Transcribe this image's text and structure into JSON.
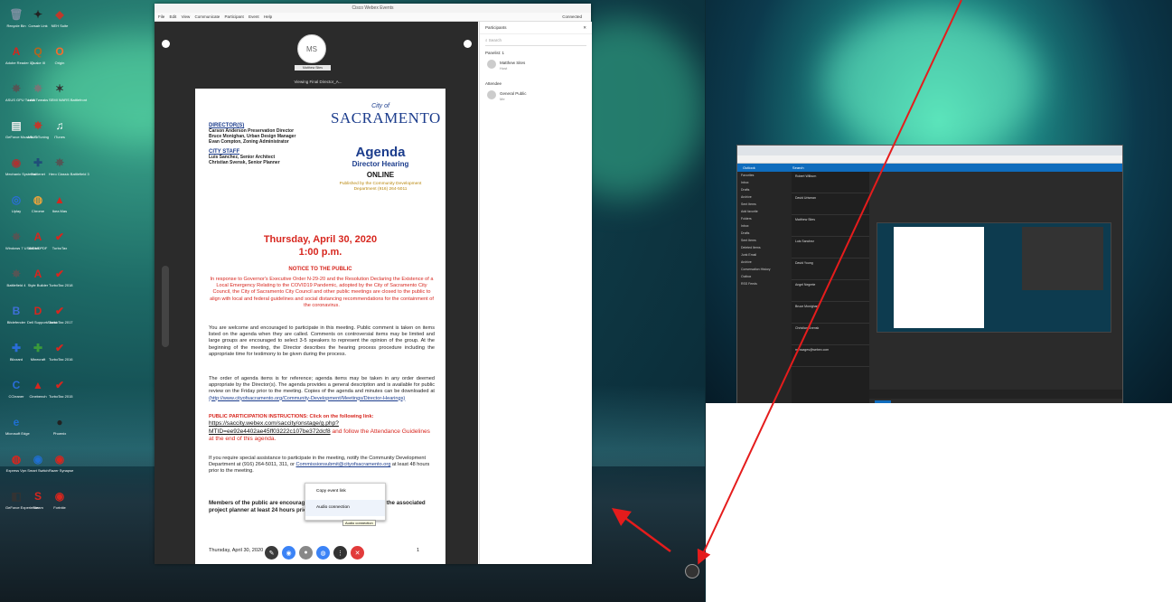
{
  "desktop": {
    "icons": [
      {
        "label": "Recycle Bin",
        "glyph": "🗑",
        "color": "#7a8fa0"
      },
      {
        "label": "Corsair Link",
        "glyph": "✦",
        "color": "#222"
      },
      {
        "label": "NEH Suite",
        "glyph": "◆",
        "color": "#c0392b"
      },
      {
        "label": "Adobe Reader XI",
        "glyph": "A",
        "color": "#d7261e"
      },
      {
        "label": "Quake III",
        "glyph": "Q",
        "color": "#b5651d"
      },
      {
        "label": "Origin",
        "glyph": "O",
        "color": "#f56c2d"
      },
      {
        "label": "ASUS GPU Tweak",
        "glyph": "✸",
        "color": "#555"
      },
      {
        "label": "LAN Tweaks",
        "glyph": "✸",
        "color": "#777"
      },
      {
        "label": "SEMI WARS Battlefront",
        "glyph": "✶",
        "color": "#333"
      },
      {
        "label": "GeForce Mozarts Gr.",
        "glyph": "▤",
        "color": "#eee"
      },
      {
        "label": "ASUS Tuning",
        "glyph": "✸",
        "color": "#c0392b"
      },
      {
        "label": "iTunes",
        "glyph": "♫",
        "color": "#fff"
      },
      {
        "label": "Mechanic Systems",
        "glyph": "◉",
        "color": "#aa3333"
      },
      {
        "label": "Battlenet",
        "glyph": "✚",
        "color": "#1f4e79"
      },
      {
        "label": "Hero Classic Battlefield 3",
        "glyph": "✸",
        "color": "#555"
      },
      {
        "label": "Uplay",
        "glyph": "◎",
        "color": "#2a6dd9"
      },
      {
        "label": "Chrome",
        "glyph": "◍",
        "color": "#e8a33d"
      },
      {
        "label": "Ikea Mas",
        "glyph": "▲",
        "color": "#d7261e"
      },
      {
        "label": "Windows 7 USB/DVD",
        "glyph": "✸",
        "color": "#555"
      },
      {
        "label": "Adobe PDF",
        "glyph": "A",
        "color": "#d7261e"
      },
      {
        "label": "TurboTax",
        "glyph": "✔",
        "color": "#d7261e"
      },
      {
        "label": "Battlefield 4",
        "glyph": "✸",
        "color": "#555"
      },
      {
        "label": "Style Builder",
        "glyph": "A",
        "color": "#d7261e"
      },
      {
        "label": "TurboTax 2018",
        "glyph": "✔",
        "color": "#d7261e"
      },
      {
        "label": "Bitdefender",
        "glyph": "B",
        "color": "#3f6fd8"
      },
      {
        "label": "Dell SupportAssist",
        "glyph": "D",
        "color": "#d7261e"
      },
      {
        "label": "TurboTax 2017",
        "glyph": "✔",
        "color": "#d7261e"
      },
      {
        "label": "Blizzard",
        "glyph": "✚",
        "color": "#2a6dd9"
      },
      {
        "label": "Minecraft",
        "glyph": "✚",
        "color": "#3a9b3a"
      },
      {
        "label": "TurboTax 2016",
        "glyph": "✔",
        "color": "#d7261e"
      },
      {
        "label": "CCleaner",
        "glyph": "C",
        "color": "#2a6dd9"
      },
      {
        "label": "Cinebench",
        "glyph": "▲",
        "color": "#d7261e"
      },
      {
        "label": "TurboTax 2015",
        "glyph": "✔",
        "color": "#d7261e"
      },
      {
        "label": "Microsoft Edge",
        "glyph": "e",
        "color": "#1f6fd1"
      },
      {
        "label": "",
        "glyph": "",
        "color": ""
      },
      {
        "label": "Phoenix",
        "glyph": "●",
        "color": "#222"
      },
      {
        "label": "Express Vpn",
        "glyph": "◍",
        "color": "#d7261e"
      },
      {
        "label": "Smart Switch",
        "glyph": "◉",
        "color": "#1f6fd1"
      },
      {
        "label": "Razer Synapse",
        "glyph": "◉",
        "color": "#d7261e"
      },
      {
        "label": "GeForce Experience",
        "glyph": "◧",
        "color": "#333"
      },
      {
        "label": "Steam",
        "glyph": "S",
        "color": "#d7261e"
      },
      {
        "label": "Fortnite",
        "glyph": "◉",
        "color": "#d7261e"
      }
    ]
  },
  "webex": {
    "title": "Cisco Webex Events",
    "menu": [
      "File",
      "Edit",
      "View",
      "Communicate",
      "Participant",
      "Event",
      "Help"
    ],
    "status": "Connected",
    "presenter_initials": "MS",
    "presenter_name": "Matthew Sites",
    "viewing": "Viewing Final Director_A...",
    "controls": [
      {
        "name": "mute-icon",
        "glyph": "✎",
        "color": "#3a3a3a"
      },
      {
        "name": "share-icon",
        "glyph": "◉",
        "color": "#3b83f6"
      },
      {
        "name": "chat-icon",
        "glyph": "●",
        "color": "#888"
      },
      {
        "name": "participants-icon",
        "glyph": "◍",
        "color": "#3b83f6"
      },
      {
        "name": "more-icon",
        "glyph": "⋮",
        "color": "#333"
      },
      {
        "name": "leave-icon",
        "glyph": "✕",
        "color": "#e23b3b"
      }
    ],
    "context_menu": {
      "copy": "Copy event link",
      "audio": "Audio connection"
    },
    "tooltip": "Audio connection",
    "participants": {
      "header": "Participants",
      "search_placeholder": "Search",
      "panelist_group": "Panelist: 1",
      "panelist_name": "Matthew Sites",
      "panelist_role": "Host",
      "attendee_group": "Attendee",
      "attendee_name": "General Public",
      "attendee_role": "Me"
    }
  },
  "document": {
    "directors_h": "DIRECTOR(S)",
    "directors": [
      "Carson Anderson Preservation Director",
      "Bruce Monighan, Urban Design Manager",
      "Evan Compton, Zoning Administrator"
    ],
    "staff_h": "CITY STAFF",
    "staff": [
      "Luis Sanchez, Senior Architect",
      "Christian Svensk, Senior Planner"
    ],
    "city_of": "City of",
    "city": "SACRAMENTO",
    "agenda": "Agenda",
    "hearing": "Director Hearing",
    "online": "ONLINE",
    "published": "Published by the Community Development Department (916) 264-5011",
    "date_line1": "Thursday, April 30, 2020",
    "date_line2": "1:00 p.m.",
    "notice_h": "NOTICE TO THE PUBLIC",
    "notice_p": "In response to Governor's Executive Order N-29-20 and the Resolution Declaring the Existence of a Local Emergency Relating to the COVID19 Pandemic, adopted by the City of Sacramento City Council, the City of Sacramento City Council and other public meetings are closed to the public to align with local and federal guidelines and social distancing recommendations for the containment of the coronavirus.",
    "welcome_p": "You are welcome and encouraged to participate in this meeting. Public comment is taken on items listed on the agenda when they are called. Comments on controversial items may be limited and large groups are encouraged to select 3-5 speakers to represent the opinion of the group. At the beginning of the meeting, the Director describes the hearing process procedure including the appropriate time for testimony to be given during the process.",
    "order_p": "The order of agenda items is for reference; agenda items may be taken in any order deemed appropriate by the Director(s). The agenda provides a general description and is available for public review on the Friday prior to the meeting. Copies of the agenda and minutes can be downloaded at",
    "order_link": "(http://www.cityofsacramento.org/Community-Development/Meetings/Director-Hearings)",
    "ppi_label": "PUBLIC PARTICIPATION INSTRUCTIONS: Click on the following link:",
    "ppi_link": "https://saccity.webex.com/saccity/onstage/g.php?MTID=ee92e4402ae45ff03222c107be372dcf8",
    "ppi_tail": " and follow the Attendance Guidelines at the end of this agenda.",
    "assist_p": "If you require special assistance to participate in the meeting, notify the Community Development Department at (916) 264-5011, 311, or",
    "assist_link": "Commissionsubmit@cityofsacramento.org",
    "assist_tail": " at least 48 hours prior to the meeting.",
    "members_a": "Members of the public are encouraged to",
    "members_b": "il to the associated",
    "members_c": "project planner at least 24 hours prior to",
    "footer_date": "Thursday, April 30, 2020",
    "page_num": "1"
  },
  "right_screen": {
    "browser_header": "Outlook",
    "search_label": "Search",
    "nav_items": [
      "Favorites",
      "Inbox",
      "Drafts",
      "Archive",
      "Sent Items",
      "Add favorite",
      "Folders",
      "Inbox",
      "Drafts",
      "Sent Items",
      "Deleted Items",
      "Junk Email",
      "Archive",
      "Conversation History",
      "Outbox",
      "RSS Feeds"
    ],
    "mail_items": [
      "Robert Wilburn",
      "David Urisman",
      "Matthew Sites",
      "Luis Sanchez",
      "David Young",
      "Angel Negrete",
      "Bruce Monighan",
      "Christian Svensk",
      "messages@webex.com"
    ]
  }
}
